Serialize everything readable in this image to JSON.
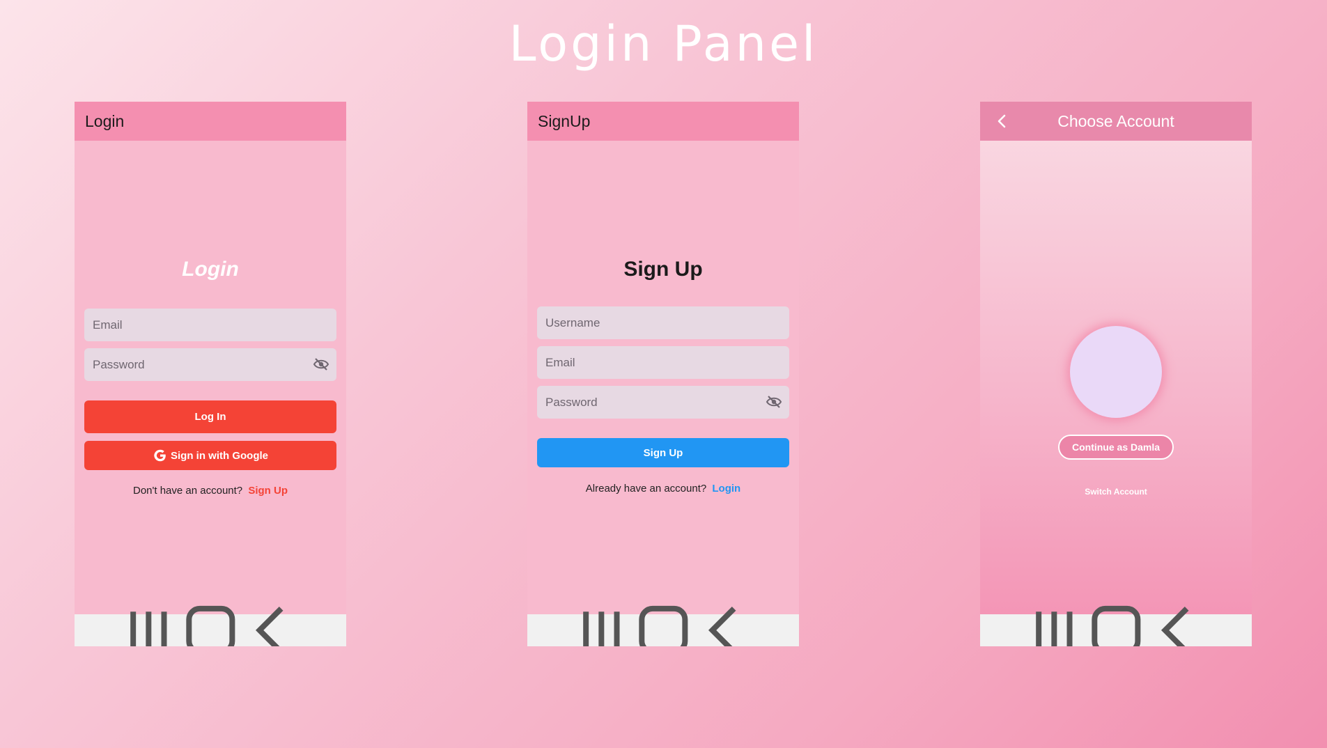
{
  "page": {
    "title": "Login Panel"
  },
  "login_screen": {
    "appbar_title": "Login",
    "form_title": "Login",
    "email_placeholder": "Email",
    "password_placeholder": "Password",
    "login_button": "Log In",
    "google_button": "Sign in with Google",
    "footer_prompt": "Don't have an account?",
    "footer_link": "Sign Up"
  },
  "signup_screen": {
    "appbar_title": "SignUp",
    "form_title": "Sign Up",
    "username_placeholder": "Username",
    "email_placeholder": "Email",
    "password_placeholder": "Password",
    "signup_button": "Sign Up",
    "footer_prompt": "Already have an account?",
    "footer_link": "Login"
  },
  "choose_screen": {
    "appbar_title": "Choose Account",
    "continue_button": "Continue as Damla",
    "switch_link": "Switch Account"
  },
  "colors": {
    "accent_red": "#f44336",
    "accent_blue": "#2196f3",
    "appbar_pink": "#f48fb0"
  },
  "icons": {
    "navbar": [
      "recents-icon",
      "home-icon",
      "back-nav-icon"
    ],
    "password_toggle": "eye-off-icon",
    "google": "google-g-icon",
    "appbar_back": "chevron-left-icon"
  }
}
